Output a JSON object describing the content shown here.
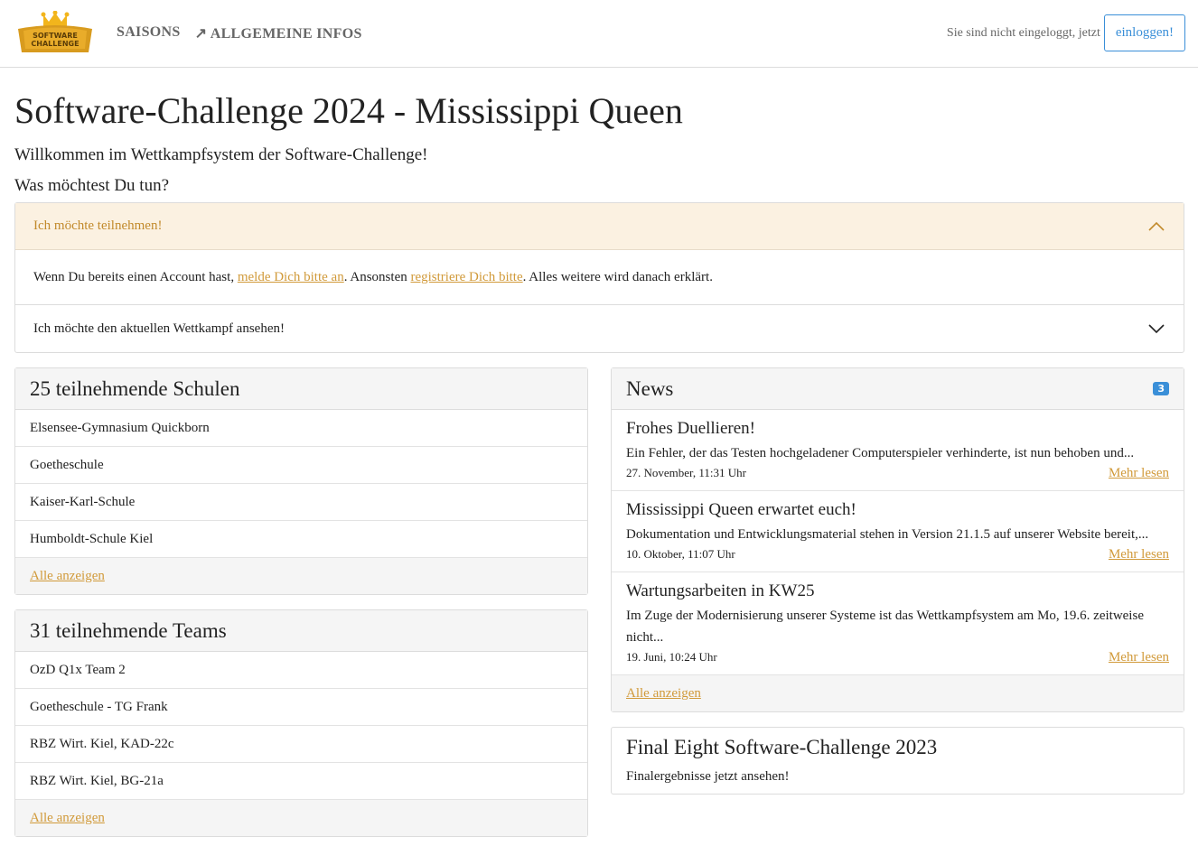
{
  "nav": {
    "logo_text": "SOFTWARE CHALLENGE",
    "saisons": "SAISONS",
    "allgemeine": "ALLGEMEINE INFOS",
    "login_text": "Sie sind nicht eingeloggt, jetzt",
    "login_button": "einloggen!"
  },
  "page": {
    "title": "Software-Challenge 2024 - Mississippi Queen",
    "welcome": "Willkommen im Wettkampfsystem der Software-Challenge!",
    "question": "Was möchtest Du tun?"
  },
  "accordion": {
    "item1_title": "Ich möchte teilnehmen!",
    "item1_text_a": "Wenn Du bereits einen Account hast, ",
    "item1_link1": "melde Dich bitte an",
    "item1_text_b": ". Ansonsten ",
    "item1_link2": "registriere Dich bitte",
    "item1_text_c": ". Alles weitere wird danach erklärt.",
    "item2_title": "Ich möchte den aktuellen Wettkampf ansehen!"
  },
  "schools": {
    "header": "25 teilnehmende Schulen",
    "items": [
      "Elsensee-Gymnasium Quickborn",
      "Goetheschule",
      "Kaiser-Karl-Schule",
      "Humboldt-Schule Kiel"
    ],
    "footer": "Alle anzeigen"
  },
  "teams": {
    "header": "31 teilnehmende Teams",
    "items": [
      "OzD Q1x Team 2",
      "Goetheschule - TG Frank",
      "RBZ Wirt. Kiel, KAD-22c",
      "RBZ Wirt. Kiel, BG-21a"
    ],
    "footer": "Alle anzeigen"
  },
  "news": {
    "header": "News",
    "badge": "3",
    "items": [
      {
        "title": "Frohes Duellieren!",
        "text": "Ein Fehler, der das Testen hochgeladener Computerspieler verhinderte, ist nun behoben und...",
        "date": "27. November, 11:31 Uhr",
        "more": "Mehr lesen"
      },
      {
        "title": "Mississippi Queen erwartet euch!",
        "text": "Dokumentation und Entwicklungsmaterial stehen in Version 21.1.5 auf unserer Website bereit,...",
        "date": "10. Oktober, 11:07 Uhr",
        "more": "Mehr lesen"
      },
      {
        "title": "Wartungsarbeiten in KW25",
        "text": "Im Zuge der Modernisierung unserer Systeme ist das Wettkampfsystem am Mo, 19.6. zeitweise nicht...",
        "date": "19. Juni, 10:24 Uhr",
        "more": "Mehr lesen"
      }
    ],
    "footer": "Alle anzeigen"
  },
  "final": {
    "title": "Final Eight Software-Challenge 2023",
    "text": "Finalergebnisse jetzt ansehen!"
  },
  "colors": {
    "accent": "#d19a3a",
    "primary": "#3a8fd8",
    "warning_bg": "#fbf1e1"
  }
}
